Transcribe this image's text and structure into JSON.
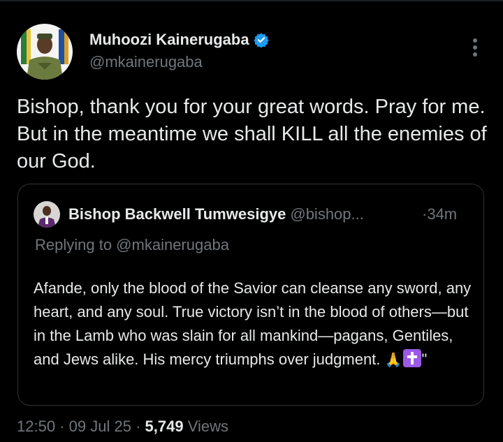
{
  "tweet": {
    "author_name": "Muhoozi Kainerugaba",
    "author_handle": "@mkainerugaba",
    "text": "Bishop, thank you for your great words. Pray for me. But in the meantime we shall KILL all the enemies of our God.",
    "time": "12:50",
    "date": "09 Jul 25",
    "views_count": "5,749",
    "views_label": "Views",
    "separator": "·"
  },
  "quote": {
    "author_name": "Bishop Backwell Tumwesigye",
    "author_handle": "@bishop...",
    "time": "34m",
    "replying_to": "Replying to @mkainerugaba",
    "text": "Afande, only the blood of the Savior can cleanse any sword, any heart, and any soul. True victory isn’t in the blood of others—but in the Lamb who was slain for all mankind—pagans, Gentiles, and Jews alike. His mercy triumphs over judgment. ",
    "emoji_pray": "🙏",
    "trailing": "\""
  },
  "colors": {
    "background": "#000000",
    "primary_text": "#e7e9ea",
    "secondary_text": "#71767b",
    "verified": "#1d9bf0",
    "border": "#2f3336"
  },
  "icons": [
    "verified-badge-icon",
    "more-options-icon",
    "folded-hands-emoji",
    "latin-cross-emoji"
  ]
}
